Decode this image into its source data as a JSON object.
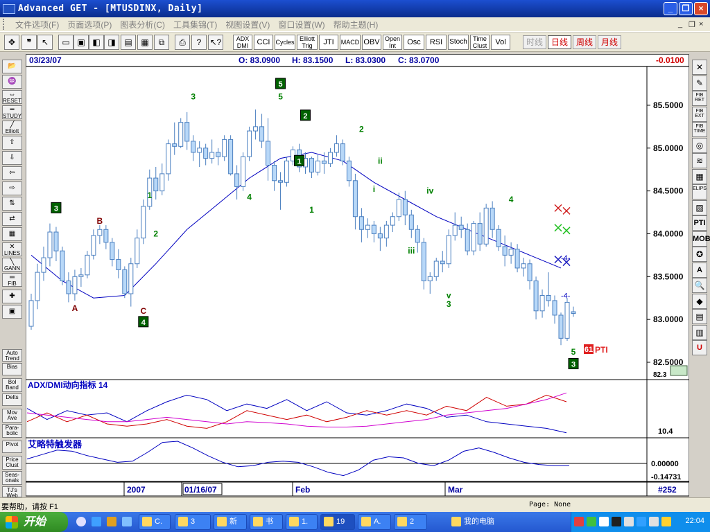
{
  "window": {
    "title": "Advanced GET - [MTUSDINX, Daily]"
  },
  "menu": {
    "items": [
      "文件选项(F)",
      "页面选项(P)",
      "图表分析(C)",
      "工具集锦(T)",
      "视图设置(V)",
      "窗口设置(W)",
      "帮助主题(H)"
    ],
    "mdi_min": "_",
    "mdi_restore": "❐",
    "mdi_close": "×"
  },
  "toolbar": {
    "study_buttons": [
      "ADX DMI",
      "CCI",
      "Cycles",
      "Elliott Trig",
      "JTI",
      "MACD",
      "OBV",
      "Open Int",
      "Osc",
      "RSI",
      "Stoch",
      "Time Clust",
      "Vol"
    ],
    "timeframes": [
      "时线",
      "日线",
      "周线",
      "月线"
    ],
    "timeframe_colors": [
      "#a0a0a0",
      "#d00000",
      "#d00000",
      "#d00000"
    ]
  },
  "info": {
    "date": "03/23/07",
    "open": "O: 83.0900",
    "high": "H: 83.1500",
    "low": "L: 83.0300",
    "close": "C: 83.0700",
    "change": "-0.0100"
  },
  "left_toolbar": [
    "",
    "",
    "RESET",
    "STUDY",
    "Elliott",
    "",
    "",
    "",
    "",
    "",
    "",
    "",
    "LINES",
    "GANN",
    "FIB",
    "",
    "",
    "Auto Trend",
    "Bias",
    "Bol Band",
    "Delts",
    "Mov Ave",
    "Para- bolic",
    "Pivot",
    "Price Clust",
    "Seas- onals",
    "TJ's Web"
  ],
  "right_toolbar": [
    "",
    "",
    "FIB RET",
    "FIB EXT",
    "FIB TIME",
    "",
    "",
    "",
    "ELIPS",
    "",
    "PTI",
    "MOB",
    "",
    "A",
    "",
    "",
    "",
    "",
    "U"
  ],
  "chart_data": {
    "type": "candlestick",
    "symbol": "MTUSDINX",
    "period": "Daily",
    "y_ticks": [
      "85.5000",
      "85.0000",
      "84.5000",
      "84.0000",
      "83.5000",
      "83.0000",
      "82.5000"
    ],
    "y_range": [
      82.33,
      85.92
    ],
    "x_labels": [
      "2007",
      "01/16/07",
      "Feb",
      "Mar"
    ],
    "x_label_boxed": "01/16/07",
    "ohlc": [
      [
        82.92,
        83.3,
        82.88,
        83.22
      ],
      [
        83.22,
        83.65,
        83.12,
        83.55
      ],
      [
        83.55,
        83.85,
        83.45,
        83.72
      ],
      [
        83.72,
        84.12,
        83.62,
        84.02
      ],
      [
        84.02,
        84.08,
        83.68,
        83.8
      ],
      [
        83.8,
        83.85,
        83.4,
        83.45
      ],
      [
        83.45,
        83.55,
        83.2,
        83.3
      ],
      [
        83.3,
        83.58,
        83.22,
        83.5
      ],
      [
        83.5,
        83.6,
        83.38,
        83.52
      ],
      [
        83.52,
        83.8,
        83.48,
        83.75
      ],
      [
        83.75,
        84.05,
        83.7,
        83.98
      ],
      [
        83.98,
        84.1,
        83.88,
        84.05
      ],
      [
        84.05,
        84.1,
        83.82,
        83.9
      ],
      [
        83.9,
        83.95,
        83.62,
        83.7
      ],
      [
        83.7,
        83.82,
        83.48,
        83.58
      ],
      [
        83.58,
        83.62,
        83.25,
        83.3
      ],
      [
        83.3,
        83.72,
        83.15,
        83.65
      ],
      [
        83.65,
        84.05,
        83.6,
        83.95
      ],
      [
        83.95,
        84.4,
        83.88,
        84.32
      ],
      [
        84.32,
        84.75,
        84.28,
        84.65
      ],
      [
        84.65,
        84.78,
        84.4,
        84.5
      ],
      [
        84.5,
        84.82,
        84.45,
        84.7
      ],
      [
        84.7,
        85.1,
        84.62,
        85.05
      ],
      [
        85.05,
        85.3,
        84.92,
        85.02
      ],
      [
        85.02,
        85.35,
        85.0,
        85.3
      ],
      [
        85.3,
        85.42,
        84.98,
        85.08
      ],
      [
        85.08,
        85.15,
        84.85,
        84.95
      ],
      [
        84.95,
        85.08,
        84.78,
        85.0
      ],
      [
        85.0,
        85.05,
        84.8,
        84.88
      ],
      [
        84.88,
        85.1,
        84.82,
        84.95
      ],
      [
        84.95,
        85.0,
        84.8,
        84.9
      ],
      [
        84.9,
        85.15,
        84.85,
        85.1
      ],
      [
        85.1,
        85.15,
        84.68,
        84.7
      ],
      [
        84.7,
        84.8,
        84.4,
        84.55
      ],
      [
        84.55,
        84.95,
        84.5,
        84.9
      ],
      [
        84.9,
        85.25,
        84.85,
        85.2
      ],
      [
        85.2,
        85.45,
        85.1,
        85.25
      ],
      [
        85.25,
        85.4,
        85.0,
        85.08
      ],
      [
        85.08,
        85.35,
        84.62,
        84.8
      ],
      [
        84.8,
        84.85,
        84.5,
        84.62
      ],
      [
        84.62,
        84.72,
        84.28,
        84.6
      ],
      [
        84.6,
        84.9,
        84.55,
        84.85
      ],
      [
        84.85,
        85.02,
        84.8,
        84.98
      ],
      [
        84.98,
        85.05,
        84.72,
        84.78
      ],
      [
        84.78,
        84.95,
        84.7,
        84.88
      ],
      [
        84.88,
        84.9,
        84.65,
        84.72
      ],
      [
        84.72,
        84.92,
        84.68,
        84.85
      ],
      [
        84.85,
        84.95,
        84.7,
        84.82
      ],
      [
        84.82,
        85.0,
        84.78,
        84.95
      ],
      [
        84.95,
        85.15,
        84.9,
        85.05
      ],
      [
        85.05,
        85.1,
        84.8,
        84.85
      ],
      [
        84.85,
        84.9,
        84.55,
        84.62
      ],
      [
        84.62,
        84.7,
        84.05,
        84.2
      ],
      [
        84.2,
        84.3,
        83.9,
        84.05
      ],
      [
        84.05,
        84.18,
        83.95,
        84.1
      ],
      [
        84.1,
        84.15,
        83.9,
        84.0
      ],
      [
        84.0,
        84.08,
        83.8,
        83.95
      ],
      [
        83.95,
        84.15,
        83.85,
        84.1
      ],
      [
        84.1,
        84.25,
        84.02,
        84.2
      ],
      [
        84.2,
        84.48,
        84.15,
        84.4
      ],
      [
        84.4,
        84.5,
        84.1,
        84.22
      ],
      [
        84.22,
        84.28,
        83.95,
        84.05
      ],
      [
        84.05,
        84.1,
        83.78,
        83.9
      ],
      [
        83.9,
        83.95,
        83.35,
        83.45
      ],
      [
        83.45,
        83.55,
        83.3,
        83.5
      ],
      [
        83.5,
        83.72,
        83.45,
        83.68
      ],
      [
        83.68,
        83.8,
        83.55,
        83.65
      ],
      [
        83.65,
        84.05,
        83.6,
        83.98
      ],
      [
        83.98,
        84.25,
        83.92,
        84.1
      ],
      [
        84.1,
        84.2,
        83.95,
        84.05
      ],
      [
        84.05,
        84.12,
        83.75,
        83.8
      ],
      [
        83.8,
        84.15,
        83.75,
        84.12
      ],
      [
        84.12,
        84.25,
        83.8,
        83.88
      ],
      [
        83.88,
        84.35,
        83.85,
        84.3
      ],
      [
        84.3,
        84.38,
        83.95,
        84.05
      ],
      [
        84.05,
        84.1,
        83.8,
        83.85
      ],
      [
        83.85,
        83.98,
        83.62,
        83.75
      ],
      [
        83.75,
        83.9,
        83.65,
        83.82
      ],
      [
        83.82,
        83.88,
        83.55,
        83.6
      ],
      [
        83.6,
        83.72,
        83.5,
        83.65
      ],
      [
        83.65,
        83.7,
        83.35,
        83.45
      ],
      [
        83.45,
        83.5,
        83.0,
        83.1
      ],
      [
        83.1,
        83.35,
        83.02,
        83.28
      ],
      [
        83.28,
        83.55,
        83.15,
        83.22
      ],
      [
        83.22,
        83.28,
        82.95,
        83.05
      ],
      [
        83.05,
        83.08,
        82.7,
        82.78
      ],
      [
        82.78,
        83.25,
        82.75,
        83.2
      ],
      [
        83.09,
        83.15,
        83.03,
        83.07
      ]
    ],
    "moving_average": [
      [
        0,
        83.75
      ],
      [
        5,
        83.45
      ],
      [
        10,
        83.25
      ],
      [
        15,
        83.28
      ],
      [
        20,
        83.65
      ],
      [
        25,
        84.05
      ],
      [
        30,
        84.35
      ],
      [
        35,
        84.65
      ],
      [
        40,
        84.88
      ],
      [
        45,
        84.95
      ],
      [
        50,
        84.85
      ],
      [
        55,
        84.6
      ],
      [
        60,
        84.4
      ],
      [
        65,
        84.2
      ],
      [
        70,
        84.05
      ],
      [
        75,
        83.9
      ],
      [
        80,
        83.75
      ],
      [
        85,
        83.6
      ]
    ],
    "wave_labels": [
      {
        "text": "3",
        "boxed": true,
        "bar": 4,
        "price": 84.3,
        "color": "#008000"
      },
      {
        "text": "A",
        "boxed": false,
        "bar": 7,
        "price": 83.13,
        "color": "#800000"
      },
      {
        "text": "B",
        "boxed": false,
        "bar": 11,
        "price": 84.15,
        "color": "#800000"
      },
      {
        "text": "C",
        "boxed": false,
        "bar": 18,
        "price": 83.1,
        "color": "#800000"
      },
      {
        "text": "4",
        "boxed": true,
        "bar": 18,
        "price": 82.97,
        "color": "#008000"
      },
      {
        "text": "1",
        "boxed": false,
        "bar": 19,
        "price": 84.45,
        "color": "#008000"
      },
      {
        "text": "2",
        "boxed": false,
        "bar": 20,
        "price": 84.0,
        "color": "#008000"
      },
      {
        "text": "3",
        "boxed": false,
        "bar": 26,
        "price": 85.6,
        "color": "#008000"
      },
      {
        "text": "4",
        "boxed": false,
        "bar": 35,
        "price": 84.43,
        "color": "#008000"
      },
      {
        "text": "5",
        "boxed": true,
        "bar": 40,
        "price": 85.75,
        "color": "#008000"
      },
      {
        "text": "5",
        "boxed": false,
        "bar": 40,
        "price": 85.6,
        "color": "#008000"
      },
      {
        "text": "2",
        "boxed": true,
        "bar": 44,
        "price": 85.38,
        "color": "#008000"
      },
      {
        "text": "1",
        "boxed": true,
        "bar": 43,
        "price": 84.85,
        "color": "#008000"
      },
      {
        "text": "1",
        "boxed": false,
        "bar": 45,
        "price": 84.28,
        "color": "#008000"
      },
      {
        "text": "2",
        "boxed": false,
        "bar": 53,
        "price": 85.22,
        "color": "#008000"
      },
      {
        "text": "ii",
        "boxed": false,
        "bar": 56,
        "price": 84.85,
        "color": "#008000"
      },
      {
        "text": "i",
        "boxed": false,
        "bar": 55,
        "price": 84.52,
        "color": "#008000"
      },
      {
        "text": "iv",
        "boxed": false,
        "bar": 64,
        "price": 84.5,
        "color": "#008000"
      },
      {
        "text": "iii",
        "boxed": false,
        "bar": 61,
        "price": 83.8,
        "color": "#008000"
      },
      {
        "text": "v",
        "boxed": false,
        "bar": 67,
        "price": 83.28,
        "color": "#008000"
      },
      {
        "text": "3",
        "boxed": false,
        "bar": 67,
        "price": 83.18,
        "color": "#008000"
      },
      {
        "text": "4",
        "boxed": false,
        "bar": 77,
        "price": 84.4,
        "color": "#008000"
      },
      {
        "text": "5",
        "boxed": false,
        "bar": 87,
        "price": 82.62,
        "color": "#008000"
      },
      {
        "text": "3",
        "boxed": true,
        "bar": 87,
        "price": 82.48,
        "color": "#008000"
      }
    ],
    "right_markers": [
      {
        "text": "-4-",
        "price": 83.72,
        "color": "#0000c0"
      },
      {
        "text": "-4-",
        "price": 83.28,
        "color": "#0000c0"
      }
    ],
    "cross_markers": [
      {
        "price": 84.3,
        "color": "#d02020"
      },
      {
        "price": 84.07,
        "color": "#20c020"
      },
      {
        "price": 83.7,
        "color": "#2020c0"
      }
    ],
    "pti": {
      "value": "61",
      "label": "PTI"
    },
    "last_price_label": "82.3",
    "adx_panel": {
      "title": "ADX/DMI动向指标 14",
      "scale_label": "10.4",
      "series": [
        {
          "color": "#0000c0",
          "values": [
            0.6,
            0.35,
            0.55,
            0.45,
            0.5,
            0.3,
            0.55,
            0.75,
            0.9,
            0.8,
            0.55,
            0.7,
            0.6,
            0.8,
            0.55,
            0.75,
            0.5,
            0.45,
            0.55,
            0.7,
            0.6,
            0.4,
            0.45,
            0.3,
            0.25,
            0.2,
            0.15,
            0.05
          ]
        },
        {
          "color": "#d00000",
          "values": [
            0.3,
            0.5,
            0.3,
            0.45,
            0.25,
            0.2,
            0.25,
            0.35,
            0.2,
            0.15,
            0.3,
            0.55,
            0.45,
            0.35,
            0.45,
            0.3,
            0.4,
            0.55,
            0.45,
            0.55,
            0.45,
            0.65,
            0.55,
            0.85,
            0.65,
            0.7,
            0.9,
            0.75
          ]
        },
        {
          "color": "#d000d0",
          "values": [
            0.5,
            0.45,
            0.4,
            0.35,
            0.3,
            0.3,
            0.35,
            0.4,
            0.35,
            0.3,
            0.25,
            0.3,
            0.28,
            0.25,
            0.2,
            0.18,
            0.18,
            0.2,
            0.25,
            0.3,
            0.35,
            0.45,
            0.5,
            0.55,
            0.6,
            0.7,
            0.8,
            0.95
          ]
        }
      ]
    },
    "osc_panel": {
      "title": "艾略特触发器",
      "zero_label": "0.00000",
      "low_label": "-0.14731",
      "values": [
        0.2,
        0.4,
        0.6,
        0.55,
        0.35,
        0.2,
        0.05,
        0.1,
        0.5,
        0.95,
        1.0,
        0.7,
        0.35,
        0.05,
        -0.15,
        -0.1,
        0.05,
        0.1,
        0.05,
        -0.15,
        -0.4,
        -0.55,
        -0.3,
        0.15,
        0.3,
        0.25,
        0.0,
        -0.1,
        0.15,
        0.55,
        0.7,
        0.5,
        0.25,
        0.05,
        -0.05,
        -0.1,
        -0.1
      ]
    }
  },
  "status": {
    "help": "要帮助，请按 F1",
    "page": "Page: None",
    "record": "#252"
  },
  "taskbar": {
    "start": "开始",
    "tasks": [
      "C.",
      "3",
      "新",
      "书",
      "1.",
      "19",
      "A.",
      "2",
      "我的电脑"
    ],
    "clock": "22:04"
  }
}
